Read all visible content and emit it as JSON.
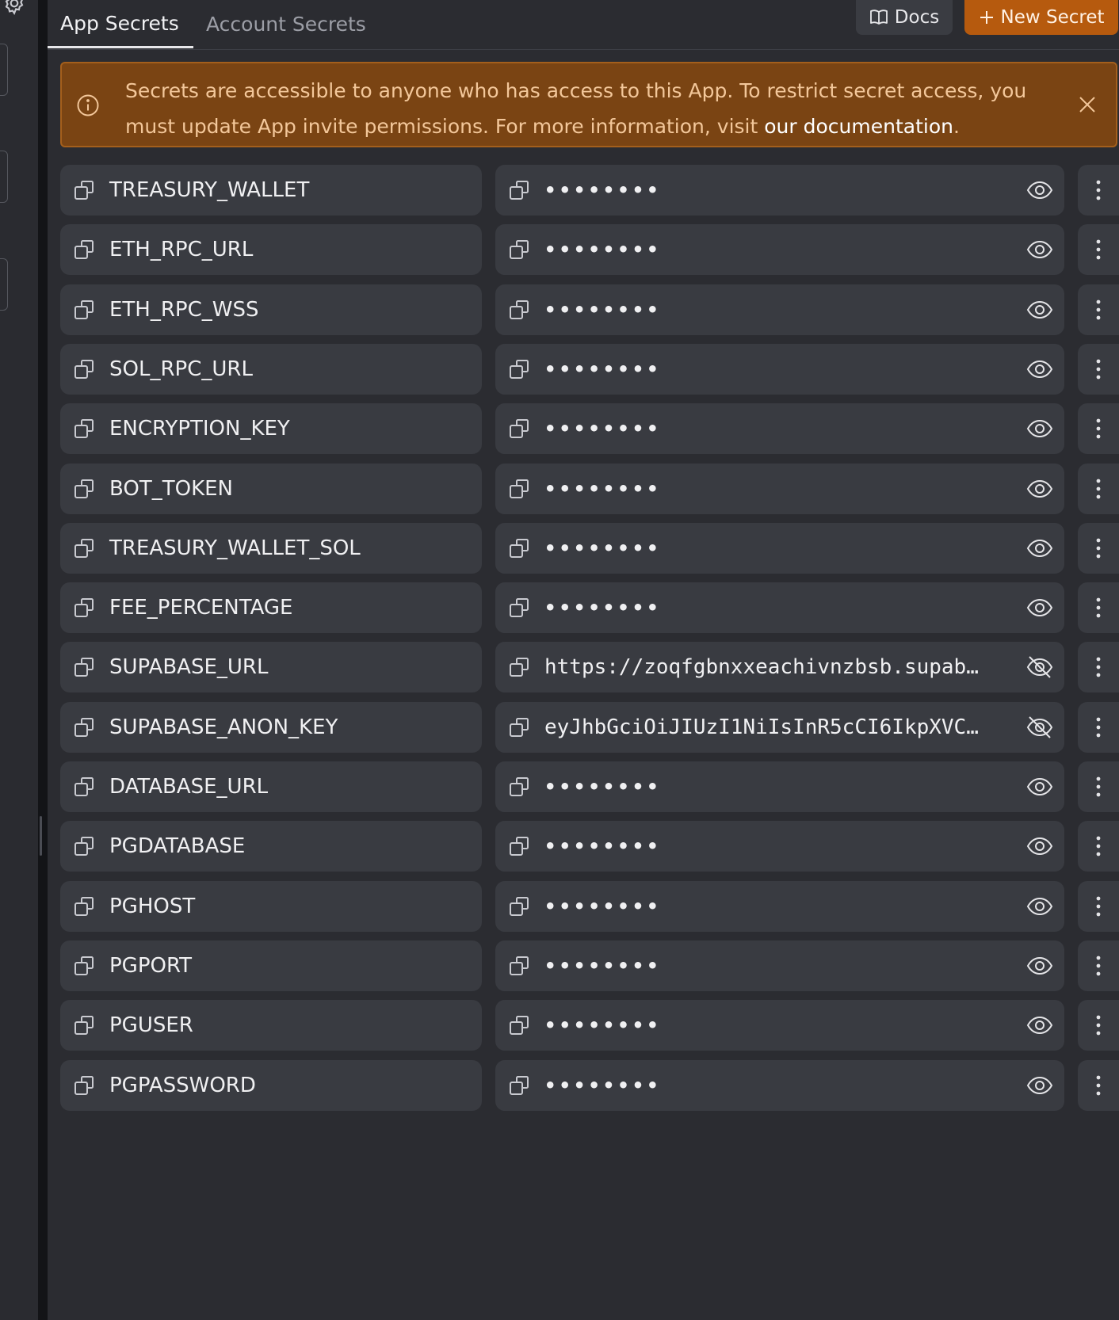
{
  "tabs": {
    "app_secrets": "App Secrets",
    "account_secrets": "Account Secrets"
  },
  "toolbar": {
    "docs_label": "Docs",
    "new_secret_label": "New Secret"
  },
  "banner": {
    "message": "Secrets are accessible to anyone who has access to this App. To restrict secret access, you must update App invite permissions. For more information, visit ",
    "link_text": "our documentation",
    "suffix": "."
  },
  "colors": {
    "accent": "#b65a0e",
    "banner_bg": "#7a4413",
    "row_bg": "#393b41",
    "page_bg": "#2b2c31"
  },
  "secrets": [
    {
      "name": "TREASURY_WALLET",
      "value": "••••••••",
      "revealed": false
    },
    {
      "name": "ETH_RPC_URL",
      "value": "••••••••",
      "revealed": false
    },
    {
      "name": "ETH_RPC_WSS",
      "value": "••••••••",
      "revealed": false
    },
    {
      "name": "SOL_RPC_URL",
      "value": "••••••••",
      "revealed": false
    },
    {
      "name": "ENCRYPTION_KEY",
      "value": "••••••••",
      "revealed": false
    },
    {
      "name": "BOT_TOKEN",
      "value": "••••••••",
      "revealed": false
    },
    {
      "name": "TREASURY_WALLET_SOL",
      "value": "••••••••",
      "revealed": false
    },
    {
      "name": "FEE_PERCENTAGE",
      "value": "••••••••",
      "revealed": false
    },
    {
      "name": "SUPABASE_URL",
      "value": "https://zoqfgbnxxeachivnzbsb.supab…",
      "revealed": true
    },
    {
      "name": "SUPABASE_ANON_KEY",
      "value": "eyJhbGciOiJIUzI1NiIsInR5cCI6IkpXVC…",
      "revealed": true
    },
    {
      "name": "DATABASE_URL",
      "value": "••••••••",
      "revealed": false
    },
    {
      "name": "PGDATABASE",
      "value": "••••••••",
      "revealed": false
    },
    {
      "name": "PGHOST",
      "value": "••••••••",
      "revealed": false
    },
    {
      "name": "PGPORT",
      "value": "••••••••",
      "revealed": false
    },
    {
      "name": "PGUSER",
      "value": "••••••••",
      "revealed": false
    },
    {
      "name": "PGPASSWORD",
      "value": "••••••••",
      "revealed": false
    }
  ]
}
